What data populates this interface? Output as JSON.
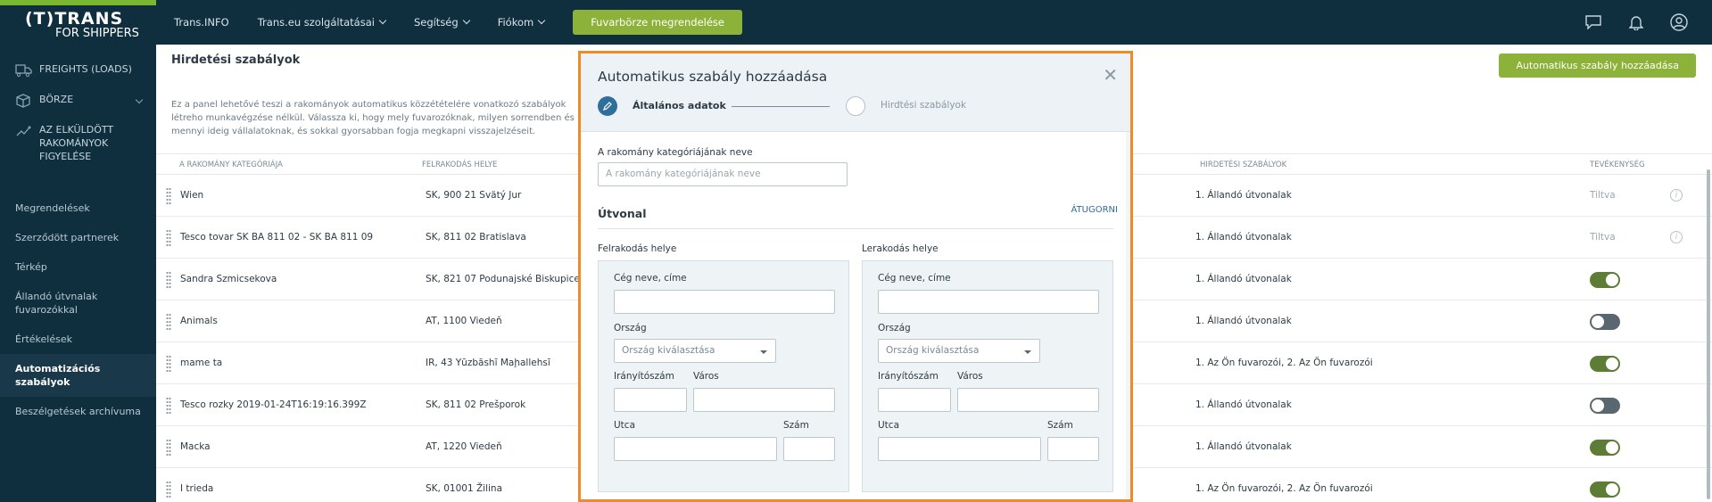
{
  "brand": {
    "line1": "(T)TRANS",
    "line2": "FOR SHIPPERS"
  },
  "nav": {
    "items": [
      {
        "label": "Trans.INFO"
      },
      {
        "label": "Trans.eu szolgáltatásai"
      },
      {
        "label": "Segítség"
      },
      {
        "label": "Fiókom"
      }
    ],
    "cta": "Fuvarbörze megrendelése"
  },
  "sidebar": {
    "main": [
      {
        "label": "FREIGHTS (LOADS)"
      },
      {
        "label": "BÖRZE"
      },
      {
        "label": "AZ ELKÜLDÖTT RAKOMÁNYOK FIGYELÉSE"
      }
    ],
    "sub": [
      {
        "label": "Megrendelések"
      },
      {
        "label": "Szerződött partnerek"
      },
      {
        "label": "Térkép"
      },
      {
        "label": "Állandó útvnalak fuvarozókkal"
      },
      {
        "label": "Értékelések"
      },
      {
        "label": "Automatizációs szabályok"
      },
      {
        "label": "Beszélgetések archívuma"
      }
    ]
  },
  "page": {
    "title": "Hirdetési szabályok",
    "add_button": "Automatikus szabály hozzáadása",
    "description": "Ez a panel lehetővé teszi a rakományok automatikus közzétételére vonatkozó szabályok létreho munkavégzése nélkül. Válassza ki, hogy mely fuvarozóknak, milyen sorrendben és mennyi ideig vállalatoknak, és sokkal gyorsabban fogja megkapni visszajelzéseit."
  },
  "table": {
    "headers": {
      "category": "A RAKOMÁNY KATEGÓRIÁJA",
      "loading": "FELRAKODÁS HELYE",
      "rules": "HIRDETÉSI SZABÁLYOK",
      "activity": "TEVÉKENYSÉG"
    },
    "rows": [
      {
        "name": "Wien",
        "place": "SK, 900 21 Svätý Jur",
        "rules": "1. Állandó útvonalak",
        "status": "Tiltva",
        "toggle": null
      },
      {
        "name": "Tesco tovar SK BA 811 02 - SK BA 811 09",
        "place": "SK, 811 02 Bratislava",
        "rules": "1. Állandó útvonalak",
        "status": "Tiltva",
        "toggle": null
      },
      {
        "name": "Sandra Szmicsekova",
        "place": "SK, 821 07 Podunajské Biskupice",
        "rules": "1. Állandó útvonalak",
        "status": "",
        "toggle": true
      },
      {
        "name": "Animals",
        "place": "AT, 1100 Viedeň",
        "rules": "1. Állandó útvonalak",
        "status": "",
        "toggle": false
      },
      {
        "name": "mame ta",
        "place": "IR, 43 Yūzbāshī Maḩallehsī",
        "rules": "1. Az Ön fuvarozói, 2. Az Ön fuvarozói",
        "status": "",
        "toggle": true
      },
      {
        "name": "Tesco rozky 2019-01-24T16:19:16.399Z",
        "place": "SK, 811 02 Prešporok",
        "rules": "1. Állandó útvonalak",
        "status": "",
        "toggle": false
      },
      {
        "name": "Macka",
        "place": "AT, 1220 Viedeň",
        "rules": "1. Állandó útvonalak",
        "status": "",
        "toggle": true
      },
      {
        "name": "I trieda",
        "place": "SK, 01001 Žilina",
        "rules": "1. Az Ön fuvarozói, 2. Az Ön fuvarozói",
        "status": "",
        "toggle": true
      }
    ]
  },
  "modal": {
    "title": "Automatikus szabály hozzáadása",
    "step1": "Általános adatok",
    "step2": "Hirdtési szabályok",
    "category_label": "A rakomány kategóriájának neve",
    "category_placeholder": "A rakomány kategóriájának neve",
    "route_title": "Útvonal",
    "skip": "ÁTUGORNI",
    "loading": {
      "title": "Felrakodás helye",
      "company_label": "Cég neve, címe",
      "country_label": "Ország",
      "country_select": "Ország kiválasztása",
      "zip_label": "Irányítószám",
      "city_label": "Város",
      "street_label": "Utca",
      "number_label": "Szám"
    },
    "unloading": {
      "title": "Lerakodás helye",
      "company_label": "Cég neve, címe",
      "country_label": "Ország",
      "country_select": "Ország kiválasztása",
      "zip_label": "Irányítószám",
      "city_label": "Város",
      "street_label": "Utca",
      "number_label": "Szám"
    }
  },
  "colors": {
    "sidebar": "#0f2f3f",
    "accent": "#8cb23a",
    "modal_border": "#f08a24",
    "toggle_on": "#5d7d35"
  },
  "icons": [
    "truck-icon",
    "box-icon",
    "tracking-icon",
    "chat-icon",
    "bell-icon",
    "user-icon",
    "close-icon",
    "pencil-icon",
    "grip-icon",
    "info-icon"
  ]
}
